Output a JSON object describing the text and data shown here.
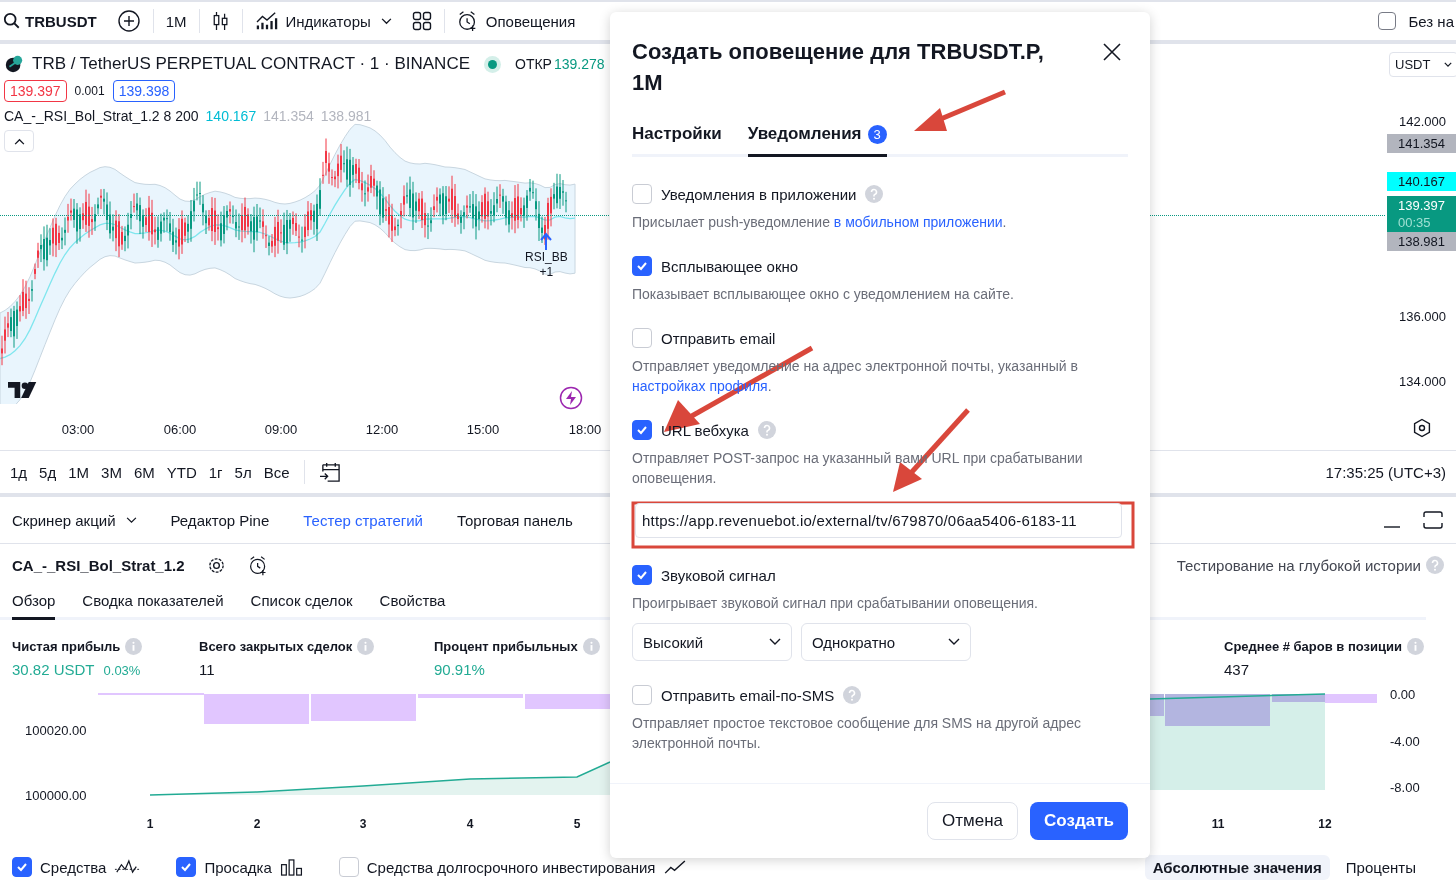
{
  "toolbar": {
    "symbol": "TRBUSDT",
    "interval": "1M",
    "indicators": "Индикаторы",
    "alerts": "Оповещения",
    "layout_name": "Без на",
    "layout_checked": false
  },
  "chart": {
    "title": "TRB / TetherUS PERPETUAL CONTRACT · 1 · BINANCE",
    "open_label": "ОТКР",
    "open_value": "139.278",
    "sell": "139.397",
    "spread": "0.001",
    "buy": "139.398",
    "indicator": {
      "name": "CA_-_RSI_Bol_Strat_1.2 8 200",
      "basis": "140.167",
      "upper": "141.354",
      "lower": "138.981"
    },
    "currency": "USDT",
    "price_ticks": [
      "142.000",
      "136.000",
      "134.000"
    ],
    "price_tags": [
      {
        "text": "141.354",
        "kind": "band"
      },
      {
        "text": "140.167",
        "kind": "basis"
      },
      {
        "text": "139.397",
        "sub": "00:35",
        "kind": "last"
      },
      {
        "text": "138.981",
        "kind": "band"
      }
    ],
    "time_ticks": [
      "03:00",
      "06:00",
      "09:00",
      "12:00",
      "15:00",
      "18:00"
    ],
    "signal": {
      "label": "RSI_BB",
      "count": "+1"
    }
  },
  "ranges": [
    "1д",
    "5д",
    "1М",
    "3М",
    "6М",
    "YTD",
    "1г",
    "5л",
    "Все"
  ],
  "clock": "17:35:25 (UTC+3)",
  "panel_tabs": [
    {
      "label": "Скринер акций",
      "selected": false,
      "dropdown": true
    },
    {
      "label": "Редактор Pine",
      "selected": false,
      "dropdown": false
    },
    {
      "label": "Тестер стратегий",
      "selected": true,
      "dropdown": false
    },
    {
      "label": "Торговая панель",
      "selected": false,
      "dropdown": false
    }
  ],
  "strategy": {
    "name": "CA_-_RSI_Bol_Strat_1.2",
    "deep_history": "Тестирование на глубокой истории"
  },
  "report_tabs": [
    {
      "label": "Обзор",
      "selected": true
    },
    {
      "label": "Сводка показателей",
      "selected": false
    },
    {
      "label": "Список сделок",
      "selected": false
    },
    {
      "label": "Свойства",
      "selected": false
    }
  ],
  "metrics": [
    {
      "label": "Чистая прибыль",
      "value": "30.82 USDT",
      "extra": "0.03%",
      "positive": true
    },
    {
      "label": "Всего закрытых сделок",
      "value": "11",
      "positive": false
    },
    {
      "label": "Процент прибыльных",
      "value": "90.91%",
      "positive": true
    },
    {
      "label": "Среднее # баров в позиции",
      "value": "437",
      "positive": false
    }
  ],
  "equity": {
    "left_ticks": [
      "100020.00",
      "100000.00"
    ],
    "right_ticks": [
      "0.00",
      "-4.00",
      "-8.00"
    ],
    "x_labels": [
      "1",
      "2",
      "3",
      "4",
      "5",
      "11",
      "12"
    ]
  },
  "legend": [
    {
      "label": "Средства",
      "checked": true,
      "kind": "line"
    },
    {
      "label": "Просадка",
      "checked": true,
      "kind": "bars"
    },
    {
      "label": "Средства долгосрочного инвестирования",
      "checked": false,
      "kind": "trend"
    }
  ],
  "value_modes": [
    {
      "label": "Абсолютные значения",
      "selected": true
    },
    {
      "label": "Проценты",
      "selected": false
    }
  ],
  "dialog": {
    "title": "Создать оповещение для TRBUSDT.P, 1M",
    "tabs": [
      {
        "label": "Настройки",
        "selected": false
      },
      {
        "label": "Уведомления",
        "badge": "3",
        "selected": true
      }
    ],
    "options": [
      {
        "label": "Уведомления в приложении",
        "checked": false,
        "help": true,
        "description": "Присылает push-уведомление ",
        "link": "в мобильном приложении",
        "after": "."
      },
      {
        "label": "Всплывающее окно",
        "checked": true,
        "help": false,
        "description": "Показывает всплывающее окно с уведомлением на сайте."
      },
      {
        "label": "Отправить email",
        "checked": false,
        "help": false,
        "description": "Отправляет уведомление на адрес электронной почты, указанный в ",
        "link": "настройках профиля",
        "after": "."
      },
      {
        "label": "URL вебхука",
        "checked": true,
        "help": true,
        "description": "Отправляет POST-запрос на указанный вами URL при срабатывании оповещения.",
        "url": "https://app.revenuebot.io/external/tv/679870/06aa5406-6183-11"
      },
      {
        "label": "Звуковой сигнал",
        "checked": true,
        "help": false,
        "description": "Проигрывает звуковой сигнал при срабатывании оповещения.",
        "selects": [
          "Высокий",
          "Однократно"
        ]
      },
      {
        "label": "Отправить email-по-SMS",
        "checked": false,
        "help": true,
        "description": "Отправляет простое текстовое сообщение для SMS на другой адрес электронной почты."
      }
    ],
    "cancel": "Отмена",
    "create": "Создать"
  }
}
